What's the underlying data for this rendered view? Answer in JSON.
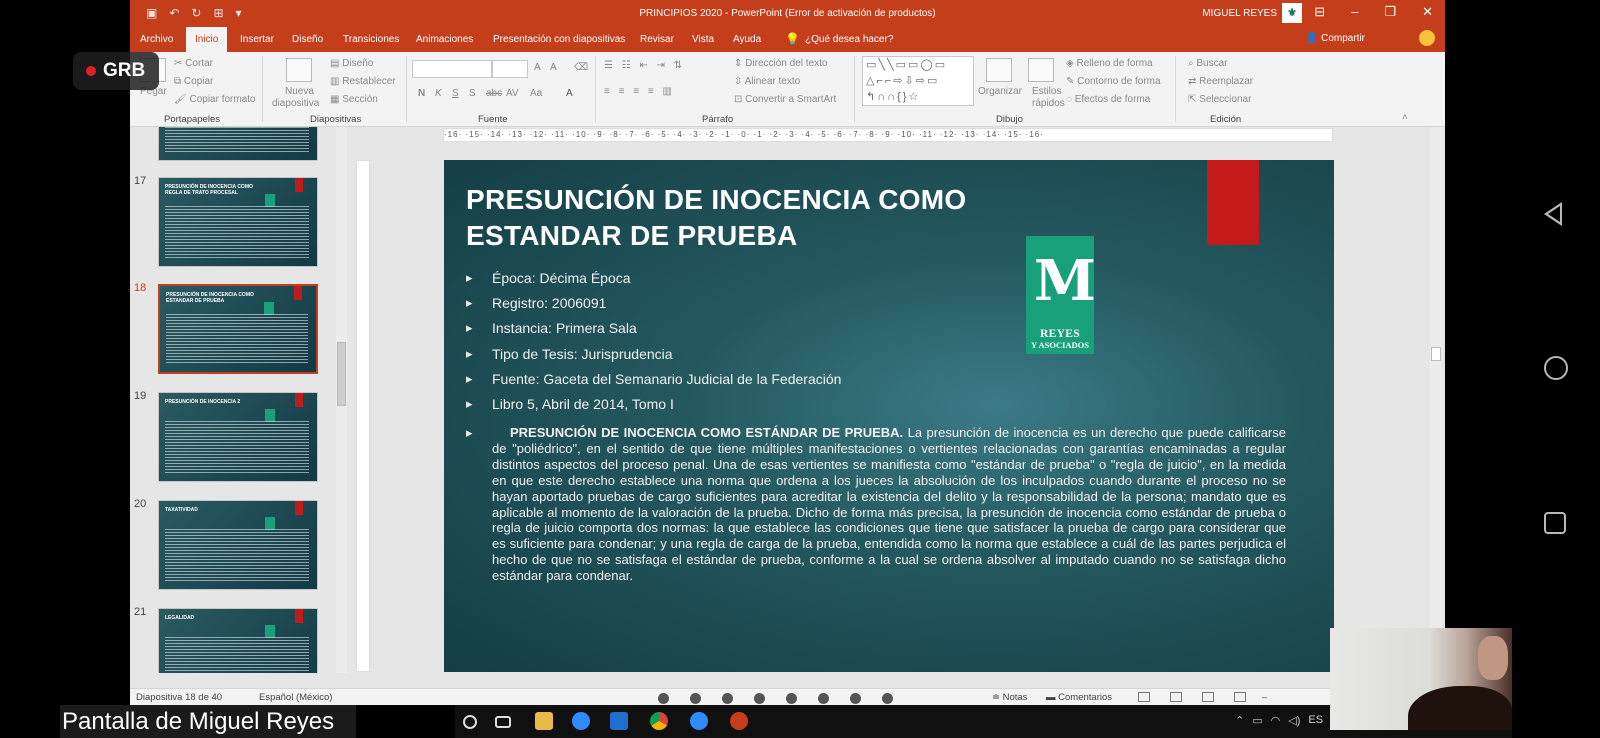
{
  "window": {
    "title": "PRINCIPIOS 2020  -  PowerPoint (Error de activación de productos)",
    "user": "MIGUEL REYES"
  },
  "tabs": [
    {
      "label": "Archivo",
      "active": false
    },
    {
      "label": "Inicio",
      "active": true
    },
    {
      "label": "Insertar",
      "active": false
    },
    {
      "label": "Diseño",
      "active": false
    },
    {
      "label": "Transiciones",
      "active": false
    },
    {
      "label": "Animaciones",
      "active": false
    },
    {
      "label": "Presentación con diapositivas",
      "active": false
    },
    {
      "label": "Revisar",
      "active": false
    },
    {
      "label": "Vista",
      "active": false
    },
    {
      "label": "Ayuda",
      "active": false
    }
  ],
  "tell_me": "¿Qué desea hacer?",
  "share_label": "Compartir",
  "ribbon": {
    "clipboard": {
      "paste": "Pegar",
      "cut": "Cortar",
      "copy": "Copiar",
      "format_painter": "Copiar formato",
      "group": "Portapapeles"
    },
    "slides": {
      "new_slide": "Nueva",
      "new_slide2": "diapositiva",
      "layout": "Diseño",
      "reset": "Restablecer",
      "section": "Sección",
      "group": "Diapositivas"
    },
    "font": {
      "bold": "N",
      "italic": "K",
      "underline": "S",
      "strike": "S",
      "shadow": "abc",
      "spacing": "AV",
      "case": "Aa",
      "color": "A",
      "grow": "A",
      "shrink": "A",
      "group": "Fuente"
    },
    "paragraph": {
      "text_direction": "Dirección del texto",
      "align_text": "Alinear texto",
      "smartart": "Convertir a SmartArt",
      "group": "Párrafo"
    },
    "drawing": {
      "arrange": "Organizar",
      "styles": "Estilos",
      "styles2": "rápidos",
      "fill": "Relleno de forma",
      "outline": "Contorno de forma",
      "effects": "Efectos de forma",
      "group": "Dibujo"
    },
    "editing": {
      "find": "Buscar",
      "replace": "Reemplazar",
      "select": "Seleccionar",
      "group": "Edición"
    }
  },
  "ruler_text": "·16· ·15· ·14· ·13· ·12· ·11· ·10· ·9· ·8· ·7· ·6· ·5· ·4· ·3· ·2· ·1· ·0· ·1· ·2· ·3· ·4· ·5· ·6· ·7· ·8· ·9· ·10· ·11· ·12· ·13· ·14· ·15· ·16·",
  "thumbnails": [
    {
      "number": "17",
      "title": "PRESUNCIÓN DE INOCENCIA COMO REGLA DE TRATO PROCESAL",
      "selected": false
    },
    {
      "number": "18",
      "title": "PRESUNCIÓN DE INOCENCIA COMO ESTANDAR DE PRUEBA",
      "selected": true
    },
    {
      "number": "19",
      "title": "PRESUNCIÓN DE INOCENCIA 2",
      "selected": false
    },
    {
      "number": "20",
      "title": "TAXATIVIDAD",
      "selected": false
    },
    {
      "number": "21",
      "title": "LEGALIDAD",
      "selected": false
    }
  ],
  "slide": {
    "title": "PRESUNCIÓN DE INOCENCIA COMO\n ESTANDAR DE PRUEBA",
    "logo_line1": "REYES",
    "logo_line2": "Y ASOCIADOS",
    "bullets": [
      "Época: Décima Época",
      "Registro: 2006091",
      "Instancia: Primera Sala",
      "Tipo de Tesis: Jurisprudencia",
      "Fuente: Gaceta del Semanario Judicial de la Federación",
      "Libro 5, Abril de 2014, Tomo I"
    ],
    "paragraph_lead": "PRESUNCIÓN DE INOCENCIA COMO ESTÁNDAR DE PRUEBA.",
    "paragraph_body": " La presunción de inocencia es un derecho que puede calificarse de \"poliédrico\", en el sentido de que tiene múltiples manifestaciones o vertientes relacionadas con garantías encaminadas a regular distintos aspectos del proceso penal. Una de esas vertientes se manifiesta como \"estándar de prueba\" o \"regla de juicio\", en la medida en que este derecho establece una norma que ordena a los jueces la absolución de los inculpados cuando durante el proceso no se hayan aportado pruebas de cargo suficientes para acreditar la existencia del delito y la responsabilidad de la persona; mandato que es aplicable al momento de la valoración de la prueba. Dicho de forma más precisa, la presunción de inocencia como estándar de prueba o regla de juicio comporta dos normas: la que establece las condiciones que tiene que satisfacer la prueba de cargo para considerar que es suficiente para condenar; y una regla de carga de la prueba, entendida como la norma que establece a cuál de las partes perjudica el hecho de que no se satisfaga el estándar de prueba, conforme a la cual se ordena absolver al imputado cuando no se satisfaga dicho estándar para condenar."
  },
  "status": {
    "slide_count": "Diapositiva 18 de 40",
    "language": "Español (México)",
    "notes": "Notas",
    "comments": "Comentarios"
  },
  "overlay": {
    "recording": "GRB",
    "share_label": "Pantalla de Miguel Reyes"
  },
  "tray": {
    "lang": "ES"
  },
  "colors": {
    "accent": "#c43e1c",
    "slide_bg": "#24585f",
    "logo": "#17a07a",
    "red_bar": "#c41a1a"
  }
}
